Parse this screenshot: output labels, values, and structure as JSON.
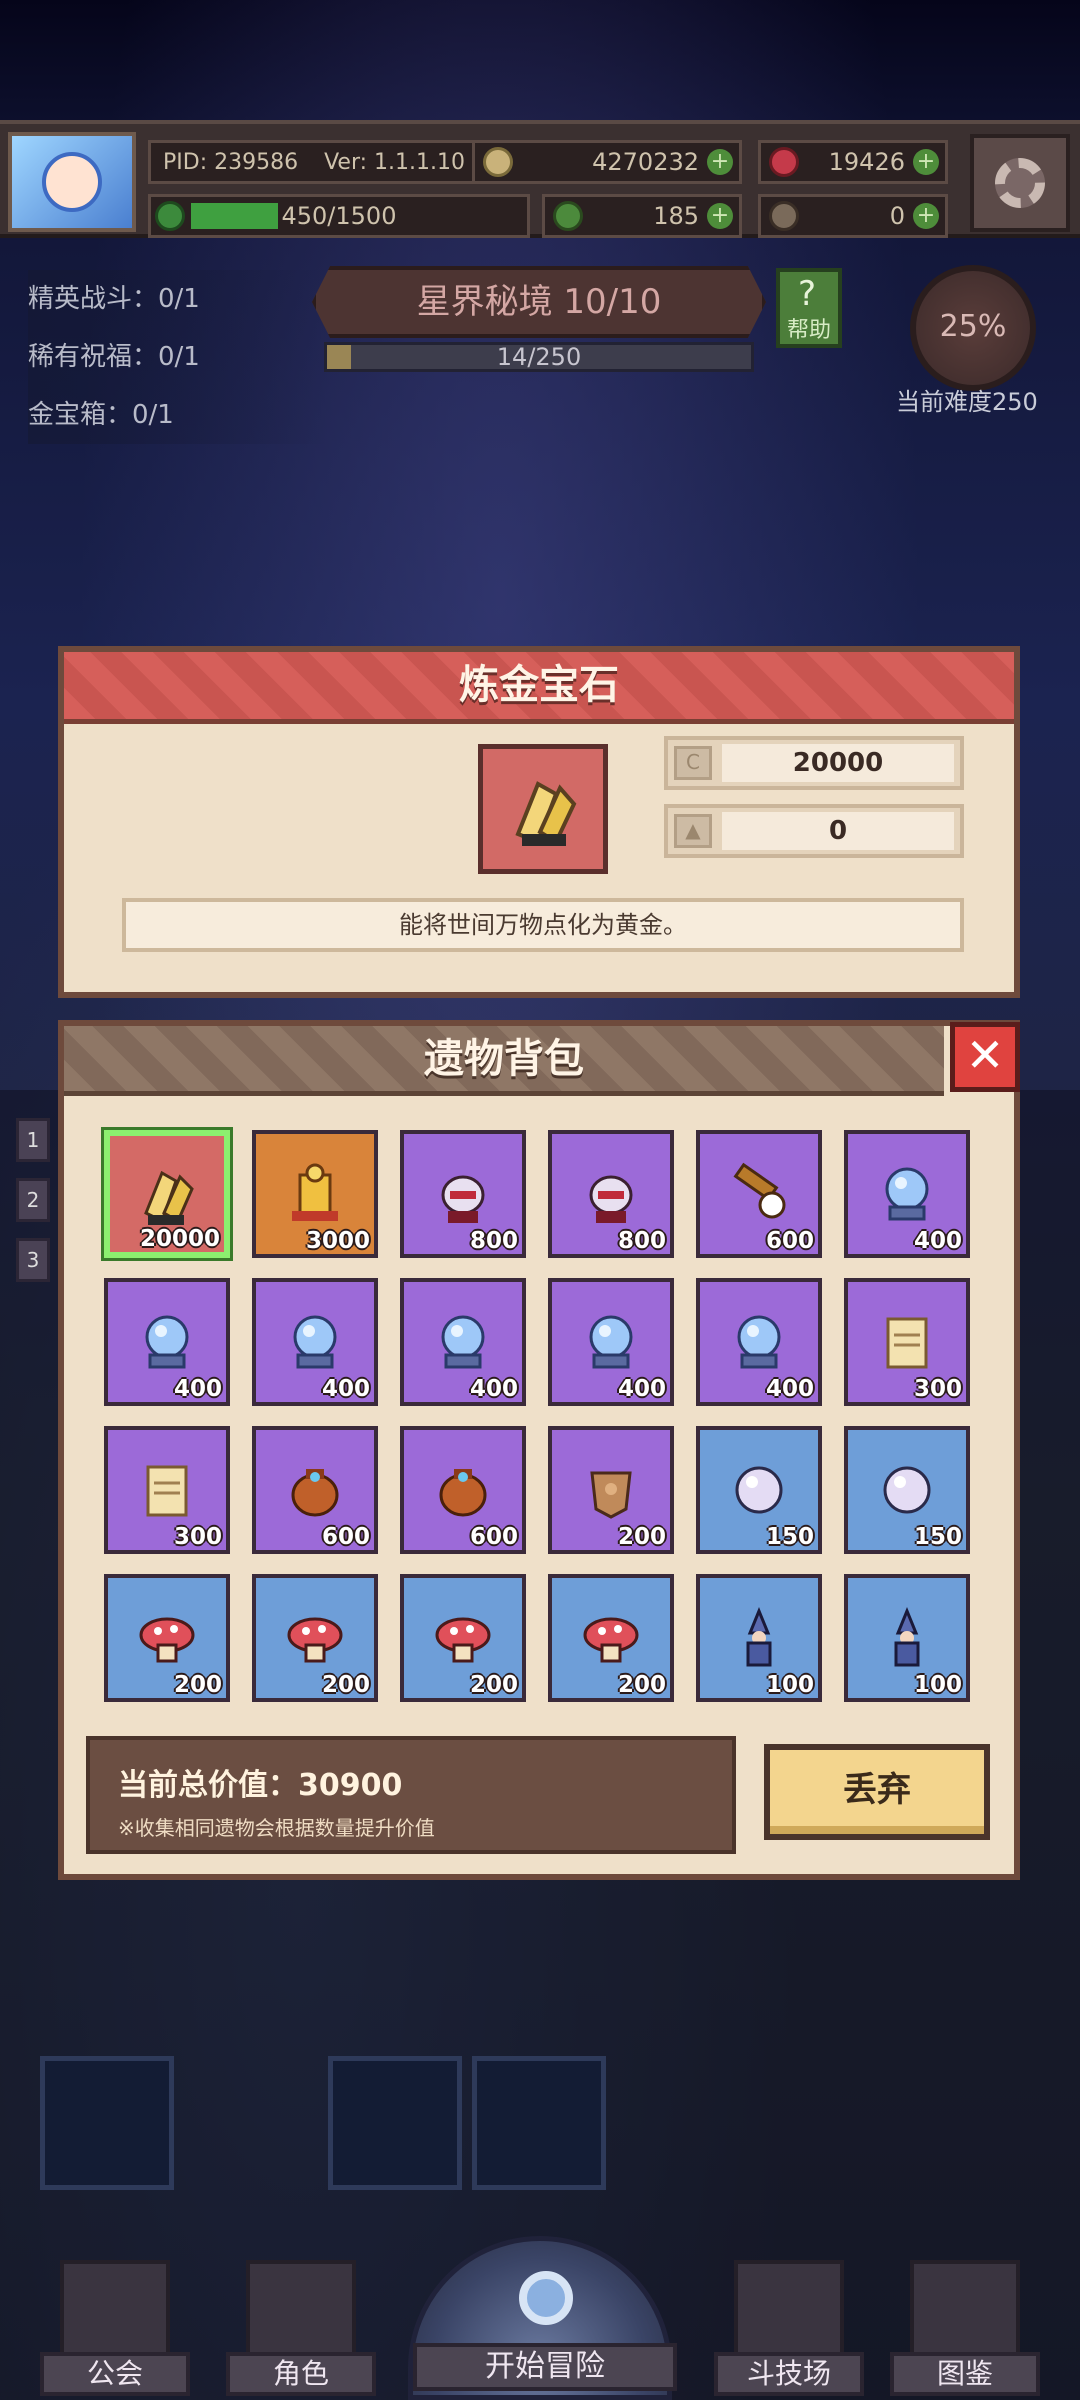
{
  "topbar": {
    "pid": "PID: 239586",
    "version": "Ver: 1.1.1.10",
    "coins": "4270232",
    "gems": "19426",
    "energy": "450/1500",
    "energy_fraction": 0.3,
    "clover": "185",
    "keys": "0"
  },
  "quests": {
    "elite": "精英战斗：0/1",
    "blessing": "稀有祝福：0/1",
    "chest": "金宝箱：0/1"
  },
  "stage": {
    "title": "星界秘境 10/10",
    "progress": "14/250",
    "progress_fraction": 0.056,
    "help": "帮助",
    "help_icon": "?",
    "difficulty_percent": "25%",
    "difficulty_label": "当前难度250"
  },
  "detail": {
    "title": "炼金宝石",
    "value_icon": "coin-value-icon",
    "value": "20000",
    "level_icon": "upgrade-arrow-icon",
    "level": "0",
    "description": "能将世间万物点化为黄金。"
  },
  "bag": {
    "title": "遗物背包",
    "close_icon": "✕",
    "items": [
      {
        "rarity": "red",
        "icon": "gold-gem-icon",
        "price": "20000",
        "selected": true
      },
      {
        "rarity": "orange",
        "icon": "golden-armor-icon",
        "price": "3000"
      },
      {
        "rarity": "purple",
        "icon": "demon-helmet-icon",
        "price": "800"
      },
      {
        "rarity": "purple",
        "icon": "demon-helmet-icon",
        "price": "800"
      },
      {
        "rarity": "purple",
        "icon": "spyglass-icon",
        "price": "600"
      },
      {
        "rarity": "purple",
        "icon": "crystal-ball-icon",
        "price": "400"
      },
      {
        "rarity": "purple",
        "icon": "crystal-ball-icon",
        "price": "400"
      },
      {
        "rarity": "purple",
        "icon": "crystal-ball-icon",
        "price": "400"
      },
      {
        "rarity": "purple",
        "icon": "crystal-ball-icon",
        "price": "400"
      },
      {
        "rarity": "purple",
        "icon": "crystal-ball-icon",
        "price": "400"
      },
      {
        "rarity": "purple",
        "icon": "crystal-ball-icon",
        "price": "400"
      },
      {
        "rarity": "purple",
        "icon": "scroll-icon",
        "price": "300"
      },
      {
        "rarity": "purple",
        "icon": "scroll-icon",
        "price": "300"
      },
      {
        "rarity": "purple",
        "icon": "treasure-bag-icon",
        "price": "600"
      },
      {
        "rarity": "purple",
        "icon": "treasure-bag-icon",
        "price": "600"
      },
      {
        "rarity": "purple",
        "icon": "leather-armor-icon",
        "price": "200"
      },
      {
        "rarity": "blue",
        "icon": "pearl-icon",
        "price": "150"
      },
      {
        "rarity": "blue",
        "icon": "pearl-icon",
        "price": "150"
      },
      {
        "rarity": "blue",
        "icon": "mushroom-icon",
        "price": "200"
      },
      {
        "rarity": "blue",
        "icon": "mushroom-icon",
        "price": "200"
      },
      {
        "rarity": "blue",
        "icon": "mushroom-icon",
        "price": "200"
      },
      {
        "rarity": "blue",
        "icon": "mushroom-icon",
        "price": "200"
      },
      {
        "rarity": "blue",
        "icon": "wizard-figure-icon",
        "price": "100"
      },
      {
        "rarity": "blue",
        "icon": "wizard-figure-icon",
        "price": "100"
      }
    ],
    "total_label": "当前总价值：30900",
    "note": "※收集相同遗物会根据数量提升价值",
    "discard": "丢弃"
  },
  "side_tabs": [
    "1",
    "2",
    "3"
  ],
  "nav": {
    "guild": "公会",
    "character": "角色",
    "adventure": "开始冒险",
    "arena": "斗技场",
    "codex": "图鉴"
  },
  "colors": {
    "rarity_red": "#d46a66",
    "rarity_orange": "#d9843a",
    "rarity_purple": "#9c6ad8",
    "rarity_blue": "#6e9ed8",
    "selected_border": "#8cf06f"
  }
}
